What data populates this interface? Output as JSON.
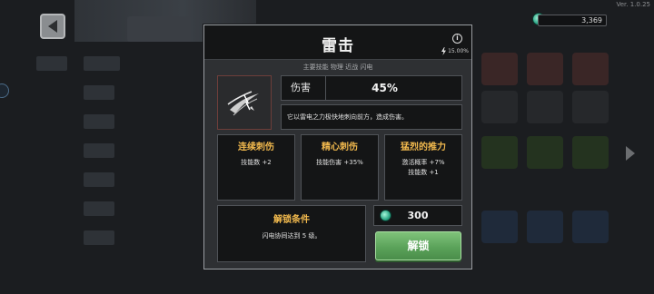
{
  "app": {
    "version": "Ver. 1.0.25",
    "currency_amount": "3,369"
  },
  "modal": {
    "title": "雷击",
    "proc_chance": "15.00%",
    "tags": "主要技能 物理 近战 闪电",
    "damage_label": "伤害",
    "damage_value": "45%",
    "description": "它以雷电之力极快地刺向前方，造成伤害。",
    "upgrades": [
      {
        "title": "连续刺伤",
        "lines": [
          "技能数 +2"
        ]
      },
      {
        "title": "精心刺伤",
        "lines": [
          "技能伤害 +35%"
        ]
      },
      {
        "title": "猛烈的推力",
        "lines": [
          "激活概率 +7%",
          "技能数 +1"
        ]
      }
    ],
    "unlock_condition_title": "解锁条件",
    "unlock_condition_text": "闪电协同达到 5 级。",
    "cost": "300",
    "unlock_button": "解锁"
  },
  "colors": {
    "accent_gold": "#f0b84d",
    "button_green": "#5ba35a",
    "icon_border": "#6e3e3a"
  },
  "icons": [
    "back-arrow-icon",
    "info-icon",
    "lightning-bolt-icon",
    "gem-icon",
    "lightning-sword-icon"
  ]
}
